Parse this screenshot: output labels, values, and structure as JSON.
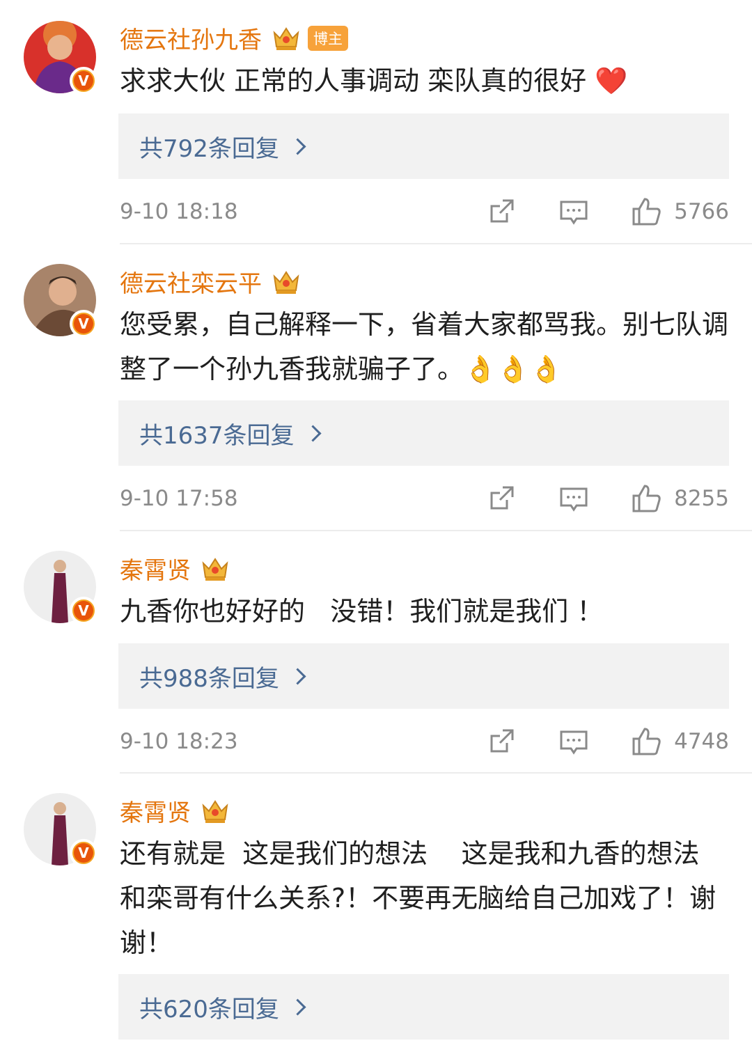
{
  "comments": [
    {
      "name": "德云社孙九香",
      "badge": "博主",
      "text": "求求大伙 正常的人事调动 栾队真的很好 ❤️",
      "replies": "共792条回复",
      "time": "9-10 18:18",
      "likes": "5766"
    },
    {
      "name": "德云社栾云平",
      "text": "您受累，自己解释一下，省着大家都骂我。别七队调整了一个孙九香我就骗子了。👌👌👌",
      "replies": "共1637条回复",
      "time": "9-10 17:58",
      "likes": "8255"
    },
    {
      "name": "秦霄贤",
      "text": "九香你也好好的   没错！我们就是我们 ！",
      "replies": "共988条回复",
      "time": "9-10 18:23",
      "likes": "4748"
    },
    {
      "name": "秦霄贤",
      "text": "还有就是  这是我们的想法    这是我和九香的想法    和栾哥有什么关系?！不要再无脑给自己加戏了！谢谢！",
      "replies": "共620条回复"
    }
  ],
  "colors": {
    "name": "#e4760f",
    "reply_link": "#4a6a93",
    "meta": "#8a8a8a",
    "reply_bg": "#f2f2f2"
  },
  "icons": [
    "share-icon",
    "comment-icon",
    "like-icon",
    "verified-v-icon",
    "crown-icon"
  ]
}
